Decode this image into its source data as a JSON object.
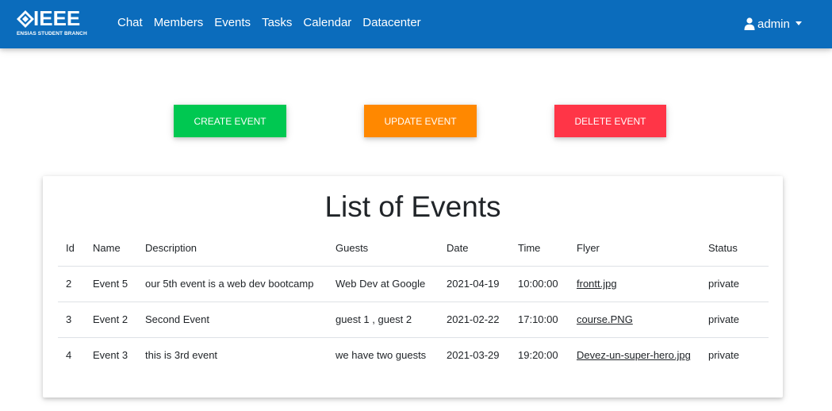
{
  "navbar": {
    "logo_text": "IEEE",
    "logo_subtext": "ENSIAS STUDENT BRANCH",
    "links": [
      "Chat",
      "Members",
      "Events",
      "Tasks",
      "Calendar",
      "Datacenter"
    ],
    "user": "admin",
    "background": "#0b6cbc"
  },
  "actions": {
    "create_label": "CREATE EVENT",
    "update_label": "UPDATE EVENT",
    "delete_label": "DELETE EVENT",
    "create_color": "#00c851",
    "update_color": "#ff8800",
    "delete_color": "#ff3547"
  },
  "events_card": {
    "title": "List of Events",
    "columns": [
      "Id",
      "Name",
      "Description",
      "Guests",
      "Date",
      "Time",
      "Flyer",
      "Status"
    ],
    "rows": [
      {
        "id": "2",
        "name": "Event 5",
        "description": "our 5th event is a web dev bootcamp",
        "guests": "Web Dev at Google",
        "date": "2021-04-19",
        "time": "10:00:00",
        "flyer": "frontt.jpg",
        "status": "private"
      },
      {
        "id": "3",
        "name": "Event 2",
        "description": "Second Event",
        "guests": "guest 1 , guest 2",
        "date": "2021-02-22",
        "time": "17:10:00",
        "flyer": "course.PNG",
        "status": "private"
      },
      {
        "id": "4",
        "name": "Event 3",
        "description": "this is 3rd event",
        "guests": "we have two guests",
        "date": "2021-03-29",
        "time": "19:20:00",
        "flyer": "Devez-un-super-hero.jpg",
        "status": "private"
      }
    ]
  }
}
